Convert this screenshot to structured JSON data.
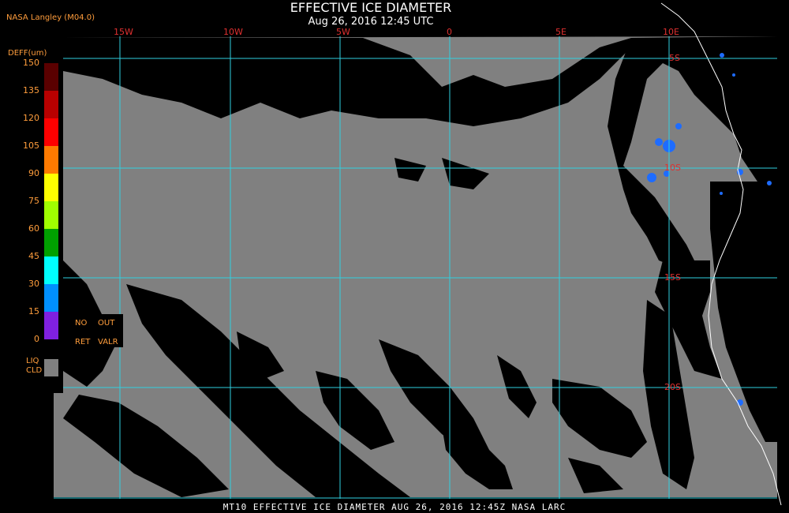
{
  "header": {
    "title": "EFFECTIVE ICE DIAMETER",
    "subtitle": "Aug 26, 2016 12:45 UTC",
    "credit": "NASA Langley (M04.0)"
  },
  "grid": {
    "lon_labels": [
      "15W",
      "10W",
      "5W",
      "0",
      "5E",
      "10E"
    ],
    "lat_labels": [
      "5S",
      "10S",
      "15S",
      "20S"
    ]
  },
  "colorbar": {
    "title": "DEFF(um)",
    "ticks": [
      "150",
      "135",
      "120",
      "105",
      "90",
      "75",
      "60",
      "45",
      "30",
      "15",
      "0"
    ],
    "colors": [
      "#5a0000",
      "#b80000",
      "#ff0000",
      "#ff7a00",
      "#ffff00",
      "#a0ff00",
      "#00a000",
      "#00ffff",
      "#0090ff",
      "#0000ff",
      "#8020e0"
    ],
    "no_ret_line1": "NO",
    "no_ret_line2": "RET",
    "out_valr_line1": "OUT",
    "out_valr_line2": "VALR",
    "liq_line1": "LIQ",
    "liq_line2": "CLD",
    "liq_color": "#808080"
  },
  "footer": {
    "text": "MT10  EFFECTIVE ICE DIAMETER  AUG 26, 2016 12:45Z  NASA LARC"
  },
  "colors": {
    "grid": "#30d0e0",
    "liquid_cloud": "#808080",
    "background": "#000000",
    "coastline": "#ffffff",
    "ice": "#1e6cff"
  }
}
